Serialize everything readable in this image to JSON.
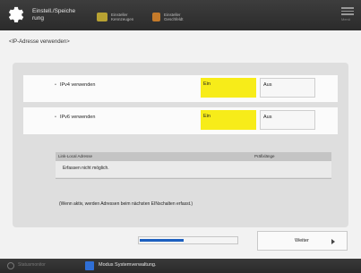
{
  "header": {
    "title": "Einstell./Speiche\nrung",
    "buttons": [
      {
        "label": "Einsteller\nKennzeugen",
        "icon": "counter-icon",
        "color": "#b8a232"
      },
      {
        "label": "Einsteller\nGeschfeldt",
        "icon": "status-icon",
        "color": "#c47a2a"
      }
    ],
    "menu_label": "Menü"
  },
  "section_title": "<IP-Adresse verwenden>",
  "settings": [
    {
      "label": "IPv4 verwenden",
      "on_label": "Ein",
      "off_label": "Aus",
      "selected": "Ein"
    },
    {
      "label": "IPv6 verwenden",
      "on_label": "Ein",
      "off_label": "Aus",
      "selected": "Ein"
    }
  ],
  "table": {
    "columns": [
      "Link-Local Adresse",
      "Präfixlänge"
    ],
    "empty_message": "Erfassen nicht möglich."
  },
  "note": "(Wenn aktiv, werden Adressen beim nächsten EINschalten erfasst.)",
  "progress": {
    "value": 0.45
  },
  "next_label": "Weiter",
  "status_bar": {
    "monitor_label": "Statusmonitor",
    "system_label": "Modus Systemverwaltung."
  },
  "colors": {
    "selected": "#f7ec19",
    "progress": "#1c5fbf",
    "header": "#333333"
  }
}
